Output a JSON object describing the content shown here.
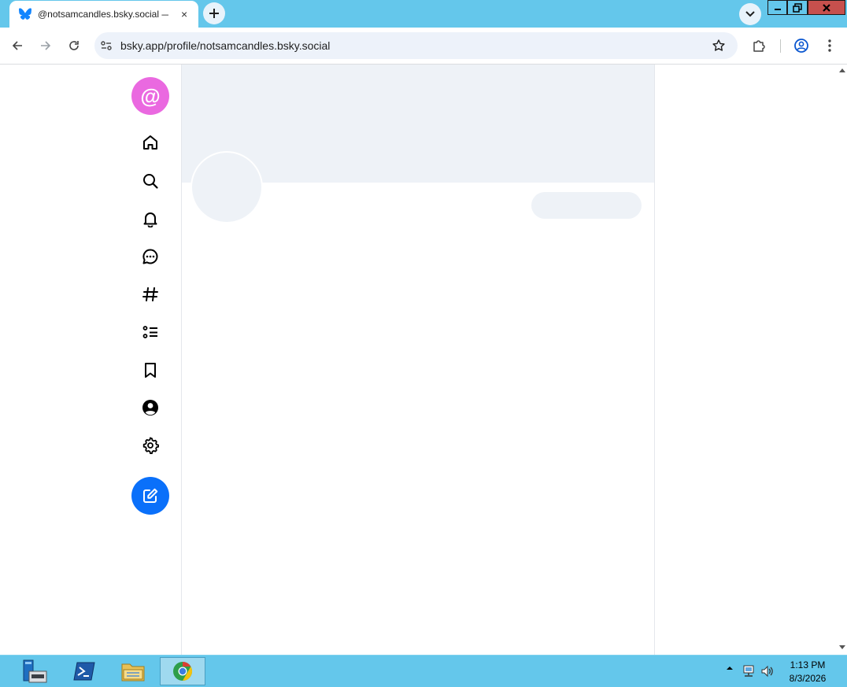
{
  "browser": {
    "tab": {
      "title": "@notsamcandles.bsky.social —",
      "close": "×"
    },
    "address_bar": {
      "url": "bsky.app/profile/notsamcandles.bsky.social"
    }
  },
  "app": {
    "logo_symbol": "@",
    "colors": {
      "logo": "#ea69e0",
      "compose": "#0a70fa",
      "placeholder": "#eef2f7"
    }
  },
  "taskbar": {
    "clock": {
      "time": "1:13 PM",
      "date": "8/3/2026"
    }
  }
}
